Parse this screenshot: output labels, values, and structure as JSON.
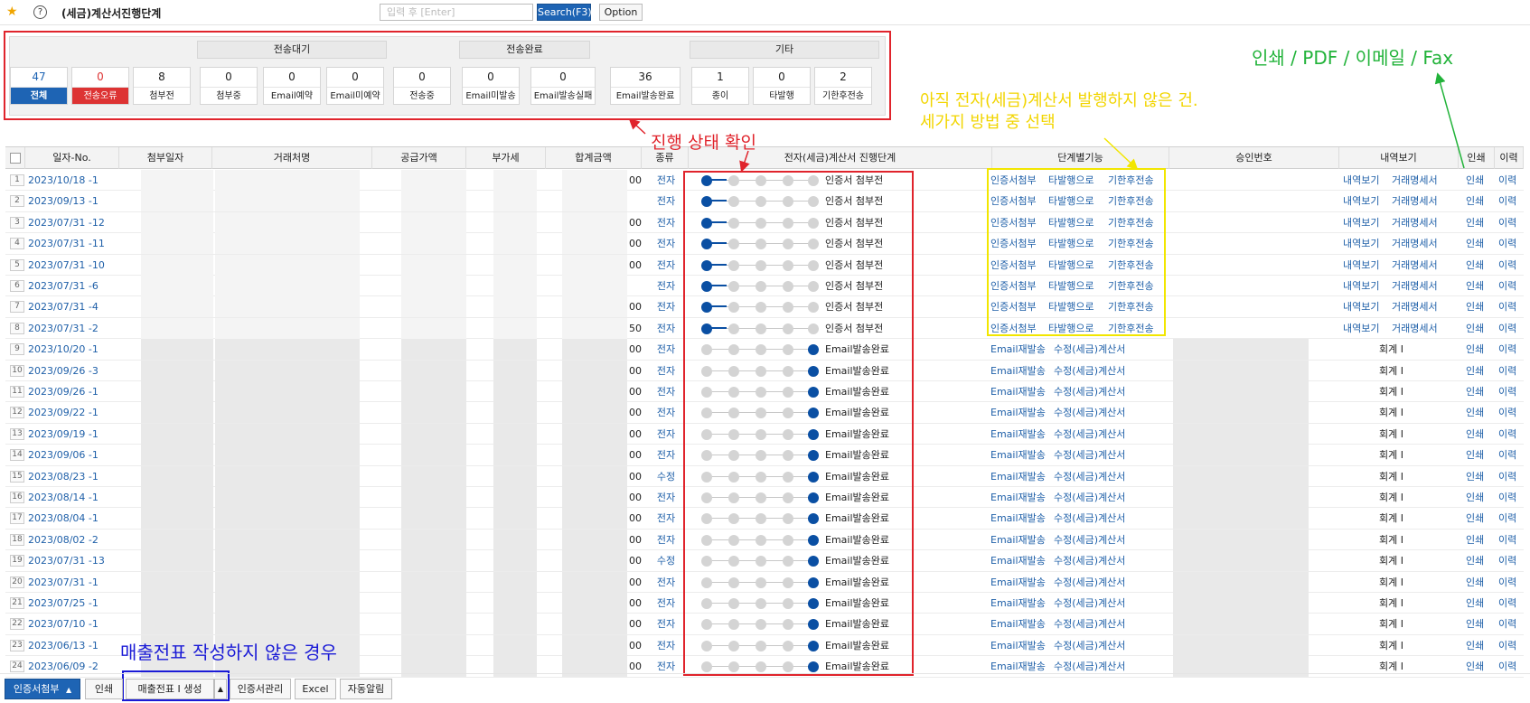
{
  "toolbar": {
    "title": "(세금)계산서진행단계",
    "search_placeholder": "입력 후 [Enter]",
    "search_button": "Search(F3)",
    "option_button": "Option"
  },
  "status": {
    "groups": [
      "전송대기",
      "전송완료",
      "기타"
    ],
    "items": [
      {
        "num": "47",
        "label": "전체"
      },
      {
        "num": "0",
        "label": "전송오류"
      },
      {
        "num": "8",
        "label": "첨부전"
      },
      {
        "num": "0",
        "label": "첨부중"
      },
      {
        "num": "0",
        "label": "Email예약"
      },
      {
        "num": "0",
        "label": "Email미예약"
      },
      {
        "num": "0",
        "label": "전송중"
      },
      {
        "num": "0",
        "label": "Email미발송"
      },
      {
        "num": "0",
        "label": "Email발송실패"
      },
      {
        "num": "36",
        "label": "Email발송완료"
      },
      {
        "num": "1",
        "label": "종이"
      },
      {
        "num": "0",
        "label": "타발행"
      },
      {
        "num": "2",
        "label": "기한후전송"
      }
    ]
  },
  "annotations": {
    "progress_note": "진행 상태 확인",
    "not_issued_line1": "아직 전자(세금)계산서 발행하지 않은 건.",
    "not_issued_line2": "세가지 방법 중 선택",
    "print_note": "인쇄 / PDF / 이메일 / Fax",
    "no_slip_note": "매출전표 작성하지 않은 경우"
  },
  "table": {
    "headers": [
      "일자-No.",
      "첨부일자",
      "거래처명",
      "공급가액",
      "부가세",
      "합계금액",
      "종류",
      "전자(세금)계산서 진행단계",
      "단계별기능",
      "승인번호",
      "내역보기",
      "인쇄",
      "이력"
    ],
    "rows": [
      {
        "n": "1",
        "date": "2023/10/18 -1",
        "amt_tail": "00",
        "kind": "전자",
        "step": 1,
        "stage": "인증서 첨부전",
        "f1": "인증서첨부",
        "f2": "타발행으로",
        "f3": "기한후전송",
        "v1": "내역보기",
        "v2": "거래명세서",
        "print": "인쇄",
        "hist": "이력"
      },
      {
        "n": "2",
        "date": "2023/09/13 -1",
        "amt_tail": "",
        "kind": "전자",
        "step": 1,
        "stage": "인증서 첨부전",
        "f1": "인증서첨부",
        "f2": "타발행으로",
        "f3": "기한후전송",
        "v1": "내역보기",
        "v2": "거래명세서",
        "print": "인쇄",
        "hist": "이력"
      },
      {
        "n": "3",
        "date": "2023/07/31 -12",
        "amt_tail": "00",
        "kind": "전자",
        "step": 1,
        "stage": "인증서 첨부전",
        "f1": "인증서첨부",
        "f2": "타발행으로",
        "f3": "기한후전송",
        "v1": "내역보기",
        "v2": "거래명세서",
        "print": "인쇄",
        "hist": "이력"
      },
      {
        "n": "4",
        "date": "2023/07/31 -11",
        "amt_tail": "00",
        "kind": "전자",
        "step": 1,
        "stage": "인증서 첨부전",
        "f1": "인증서첨부",
        "f2": "타발행으로",
        "f3": "기한후전송",
        "v1": "내역보기",
        "v2": "거래명세서",
        "print": "인쇄",
        "hist": "이력"
      },
      {
        "n": "5",
        "date": "2023/07/31 -10",
        "amt_tail": "00",
        "kind": "전자",
        "step": 1,
        "stage": "인증서 첨부전",
        "f1": "인증서첨부",
        "f2": "타발행으로",
        "f3": "기한후전송",
        "v1": "내역보기",
        "v2": "거래명세서",
        "print": "인쇄",
        "hist": "이력"
      },
      {
        "n": "6",
        "date": "2023/07/31 -6",
        "amt_tail": "",
        "kind": "전자",
        "step": 1,
        "stage": "인증서 첨부전",
        "f1": "인증서첨부",
        "f2": "타발행으로",
        "f3": "기한후전송",
        "v1": "내역보기",
        "v2": "거래명세서",
        "print": "인쇄",
        "hist": "이력"
      },
      {
        "n": "7",
        "date": "2023/07/31 -4",
        "amt_tail": "00",
        "kind": "전자",
        "step": 1,
        "stage": "인증서 첨부전",
        "f1": "인증서첨부",
        "f2": "타발행으로",
        "f3": "기한후전송",
        "v1": "내역보기",
        "v2": "거래명세서",
        "print": "인쇄",
        "hist": "이력"
      },
      {
        "n": "8",
        "date": "2023/07/31 -2",
        "amt_tail": "50",
        "kind": "전자",
        "step": 1,
        "stage": "인증서 첨부전",
        "f1": "인증서첨부",
        "f2": "타발행으로",
        "f3": "기한후전송",
        "v1": "내역보기",
        "v2": "거래명세서",
        "print": "인쇄",
        "hist": "이력"
      },
      {
        "n": "9",
        "date": "2023/10/20 -1",
        "amt_tail": "00",
        "kind": "전자",
        "step": 5,
        "stage": "Email발송완료",
        "f1": "Email재발송",
        "f2": "수정(세금)계산서",
        "f3": "",
        "v1": "회계 I",
        "v2": "",
        "print": "인쇄",
        "hist": "이력"
      },
      {
        "n": "10",
        "date": "2023/09/26 -3",
        "amt_tail": "00",
        "kind": "전자",
        "step": 5,
        "stage": "Email발송완료",
        "f1": "Email재발송",
        "f2": "수정(세금)계산서",
        "f3": "",
        "v1": "회계 I",
        "v2": "",
        "print": "인쇄",
        "hist": "이력"
      },
      {
        "n": "11",
        "date": "2023/09/26 -1",
        "amt_tail": "00",
        "kind": "전자",
        "step": 5,
        "stage": "Email발송완료",
        "f1": "Email재발송",
        "f2": "수정(세금)계산서",
        "f3": "",
        "v1": "회계 I",
        "v2": "",
        "print": "인쇄",
        "hist": "이력"
      },
      {
        "n": "12",
        "date": "2023/09/22 -1",
        "amt_tail": "00",
        "kind": "전자",
        "step": 5,
        "stage": "Email발송완료",
        "f1": "Email재발송",
        "f2": "수정(세금)계산서",
        "f3": "",
        "v1": "회계 I",
        "v2": "",
        "print": "인쇄",
        "hist": "이력"
      },
      {
        "n": "13",
        "date": "2023/09/19 -1",
        "amt_tail": "00",
        "kind": "전자",
        "step": 5,
        "stage": "Email발송완료",
        "f1": "Email재발송",
        "f2": "수정(세금)계산서",
        "f3": "",
        "v1": "회계 I",
        "v2": "",
        "print": "인쇄",
        "hist": "이력"
      },
      {
        "n": "14",
        "date": "2023/09/06 -1",
        "amt_tail": "00",
        "kind": "전자",
        "step": 5,
        "stage": "Email발송완료",
        "f1": "Email재발송",
        "f2": "수정(세금)계산서",
        "f3": "",
        "v1": "회계 I",
        "v2": "",
        "print": "인쇄",
        "hist": "이력"
      },
      {
        "n": "15",
        "date": "2023/08/23 -1",
        "amt_tail": "00",
        "kind": "수정",
        "step": 5,
        "stage": "Email발송완료",
        "f1": "Email재발송",
        "f2": "수정(세금)계산서",
        "f3": "",
        "v1": "회계 I",
        "v2": "",
        "print": "인쇄",
        "hist": "이력"
      },
      {
        "n": "16",
        "date": "2023/08/14 -1",
        "amt_tail": "00",
        "kind": "전자",
        "step": 5,
        "stage": "Email발송완료",
        "f1": "Email재발송",
        "f2": "수정(세금)계산서",
        "f3": "",
        "v1": "회계 I",
        "v2": "",
        "print": "인쇄",
        "hist": "이력"
      },
      {
        "n": "17",
        "date": "2023/08/04 -1",
        "amt_tail": "00",
        "kind": "전자",
        "step": 5,
        "stage": "Email발송완료",
        "f1": "Email재발송",
        "f2": "수정(세금)계산서",
        "f3": "",
        "v1": "회계 I",
        "v2": "",
        "print": "인쇄",
        "hist": "이력"
      },
      {
        "n": "18",
        "date": "2023/08/02 -2",
        "amt_tail": "00",
        "kind": "전자",
        "step": 5,
        "stage": "Email발송완료",
        "f1": "Email재발송",
        "f2": "수정(세금)계산서",
        "f3": "",
        "v1": "회계 I",
        "v2": "",
        "print": "인쇄",
        "hist": "이력"
      },
      {
        "n": "19",
        "date": "2023/07/31 -13",
        "amt_tail": "00",
        "kind": "수정",
        "step": 5,
        "stage": "Email발송완료",
        "f1": "Email재발송",
        "f2": "수정(세금)계산서",
        "f3": "",
        "v1": "회계 I",
        "v2": "",
        "print": "인쇄",
        "hist": "이력"
      },
      {
        "n": "20",
        "date": "2023/07/31 -1",
        "amt_tail": "00",
        "kind": "전자",
        "step": 5,
        "stage": "Email발송완료",
        "f1": "Email재발송",
        "f2": "수정(세금)계산서",
        "f3": "",
        "v1": "회계 I",
        "v2": "",
        "print": "인쇄",
        "hist": "이력"
      },
      {
        "n": "21",
        "date": "2023/07/25 -1",
        "amt_tail": "00",
        "kind": "전자",
        "step": 5,
        "stage": "Email발송완료",
        "f1": "Email재발송",
        "f2": "수정(세금)계산서",
        "f3": "",
        "v1": "회계 I",
        "v2": "",
        "print": "인쇄",
        "hist": "이력"
      },
      {
        "n": "22",
        "date": "2023/07/10 -1",
        "amt_tail": "00",
        "kind": "전자",
        "step": 5,
        "stage": "Email발송완료",
        "f1": "Email재발송",
        "f2": "수정(세금)계산서",
        "f3": "",
        "v1": "회계 I",
        "v2": "",
        "print": "인쇄",
        "hist": "이력"
      },
      {
        "n": "23",
        "date": "2023/06/13 -1",
        "amt_tail": "00",
        "kind": "전자",
        "step": 5,
        "stage": "Email발송완료",
        "f1": "Email재발송",
        "f2": "수정(세금)계산서",
        "f3": "",
        "v1": "회계 I",
        "v2": "",
        "print": "인쇄",
        "hist": "이력"
      },
      {
        "n": "24",
        "date": "2023/06/09 -2",
        "amt_tail": "00",
        "kind": "전자",
        "step": 5,
        "stage": "Email발송완료",
        "f1": "Email재발송",
        "f2": "수정(세금)계산서",
        "f3": "",
        "v1": "회계 I",
        "v2": "",
        "print": "인쇄",
        "hist": "이력"
      }
    ]
  },
  "bottom": {
    "attach_cert": "인증서첨부",
    "print": "인쇄",
    "create_slip": "매출전표 I 생성",
    "cert_manage": "인증서관리",
    "excel": "Excel",
    "auto_notice": "자동알림"
  },
  "icons": {
    "favorite": "star-icon",
    "help": "question-circle-icon",
    "dropdown": "caret-down-icon"
  },
  "colors": {
    "primary": "#1e64b4",
    "error": "#dd3333",
    "link": "#1e5fa8",
    "step_active": "#0a4fa3",
    "annot_red": "#e0242c",
    "annot_yellow": "#f2e600",
    "annot_green": "#22b33a",
    "annot_blue": "#1a1ad6"
  }
}
